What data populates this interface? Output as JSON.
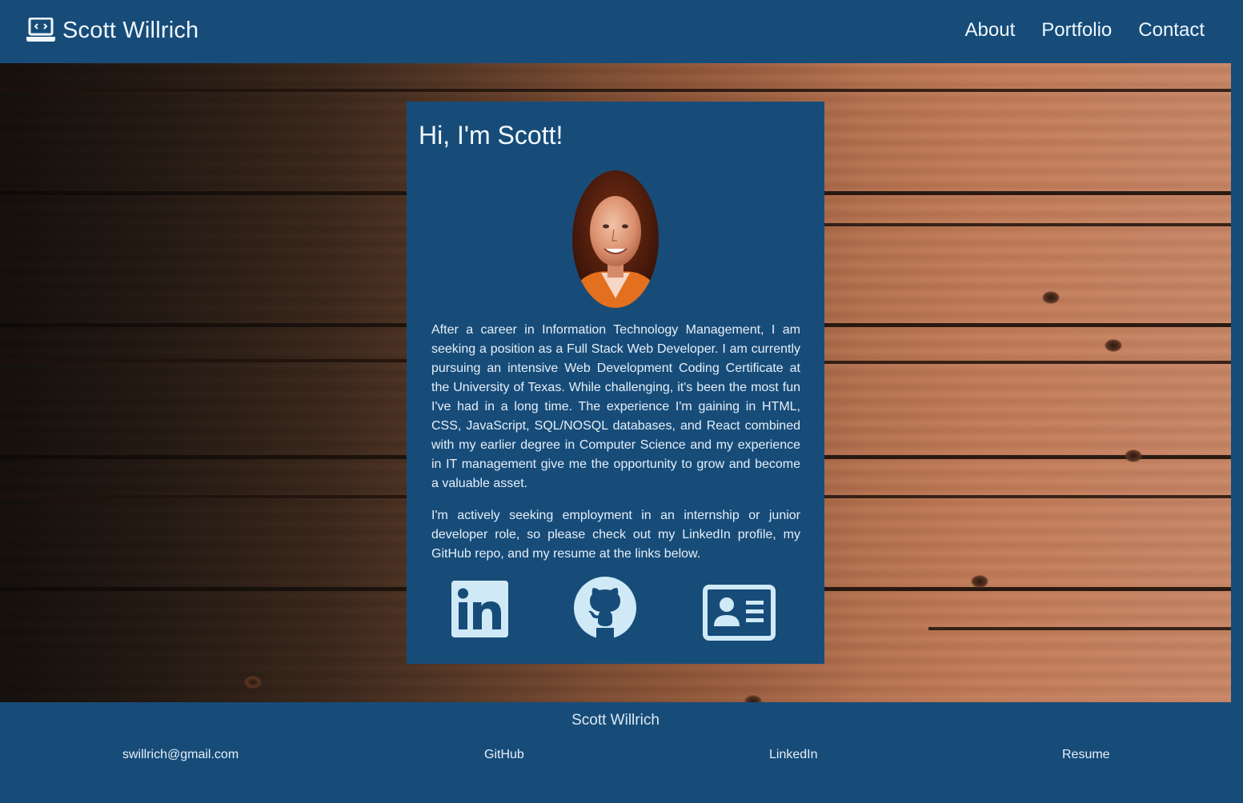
{
  "header": {
    "brand_icon": "laptop-code-icon",
    "brand_name": "Scott Willrich",
    "nav": [
      {
        "label": "About"
      },
      {
        "label": "Portfolio"
      },
      {
        "label": "Contact"
      }
    ]
  },
  "card": {
    "title": "Hi, I'm Scott!",
    "bio": [
      "After a career in Information Technology Management, I am seeking a position as a Full Stack Web Developer. I am currently pursuing an intensive Web Development Coding Certificate at the University of Texas. While challenging, it's been the most fun I've had in a long time. The experience I'm gaining in HTML, CSS, JavaScript, SQL/NOSQL databases, and React combined with my earlier degree in Computer Science and my experience in IT management give me the opportunity to grow and become a valuable asset.",
      "I'm actively seeking employment in an internship or junior developer role, so please check out my LinkedIn profile, my GitHub repo, and my resume at the links below."
    ],
    "social_icons": [
      "linkedin-icon",
      "github-icon",
      "resume-card-icon"
    ]
  },
  "footer": {
    "name": "Scott Willrich",
    "links": {
      "email": "swillrich@gmail.com",
      "github": "GitHub",
      "linkedin": "LinkedIn",
      "resume": "Resume"
    }
  },
  "colors": {
    "primary": "#174c79",
    "icon": "#cfe9f7",
    "text": "#e9f2fa"
  }
}
